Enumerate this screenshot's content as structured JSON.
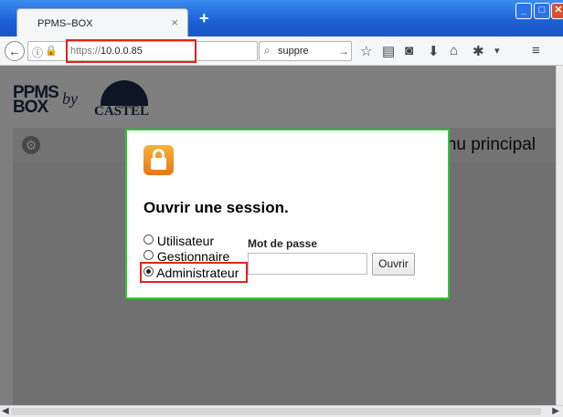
{
  "browser": {
    "tab_title": "PPMS–BOX",
    "tab_close": "×",
    "new_tab": "+",
    "url_prefix": "https://",
    "url_host": "10.0.0.85",
    "search_value": "suppre",
    "window_controls": {
      "minimize": "_",
      "maximize": "□",
      "close": "✕"
    }
  },
  "header": {
    "logo_ppms_line1": "PPMS",
    "logo_ppms_line2": "BOX",
    "logo_by": "by",
    "logo_castel": "CASTEL"
  },
  "menu": {
    "title": "Menu principal"
  },
  "dialog": {
    "title": "Ouvrir une session.",
    "roles": [
      {
        "label": "Utilisateur",
        "selected": false
      },
      {
        "label": "Gestionnaire",
        "selected": false
      },
      {
        "label": "Administrateur",
        "selected": true
      }
    ],
    "password_label": "Mot de passe",
    "password_value": "",
    "submit_label": "Ouvrir"
  },
  "colors": {
    "highlight": "#e2231a",
    "dialog_border": "#2ec82e",
    "lock_icon": "#f08a22"
  }
}
